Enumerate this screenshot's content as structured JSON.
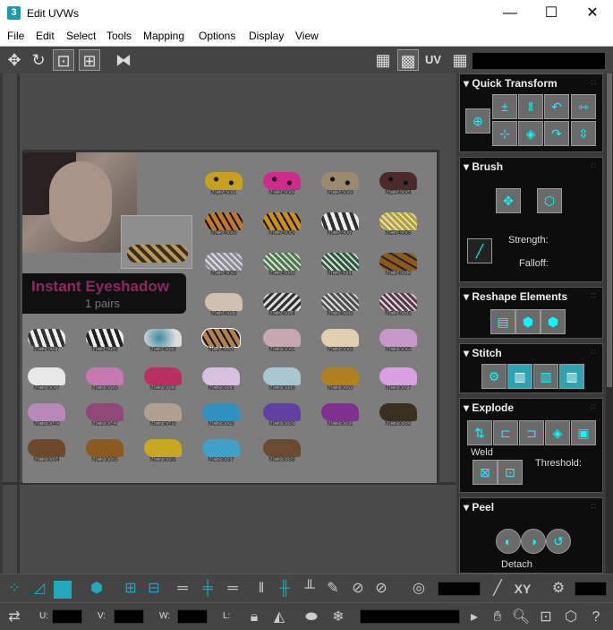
{
  "window": {
    "title": "Edit UVWs",
    "app_icon": "3",
    "minimize": "—",
    "maximize": "☐",
    "close": "✕"
  },
  "menu": [
    "File",
    "Edit",
    "Select",
    "Tools",
    "Mapping",
    "Options",
    "Display",
    "View"
  ],
  "toolbar": {
    "uv_label": "UV"
  },
  "texture": {
    "banner_title": "Instant Eyeshadow",
    "banner_sub": "1 pairs",
    "swatches": [
      {
        "id": "NC24001",
        "color": "#c8a020",
        "pattern": "leopard"
      },
      {
        "id": "NC24002",
        "color": "#d02a8a",
        "pattern": "leopard"
      },
      {
        "id": "NC24003",
        "color": "#9a8a70",
        "pattern": "leopard"
      },
      {
        "id": "NC24004",
        "color": "#4a2a2a",
        "pattern": "leopard"
      },
      {
        "id": "NC24005",
        "color": "#c07830",
        "pattern": "tiger"
      },
      {
        "id": "NC24006",
        "color": "#c89020",
        "pattern": "tiger"
      },
      {
        "id": "NC24007",
        "color": "#303030",
        "pattern": "zebra"
      },
      {
        "id": "NC24008",
        "color": "#b8a020",
        "pattern": "snake"
      },
      {
        "id": "NC24009",
        "color": "#8a8a9a",
        "pattern": "snake"
      },
      {
        "id": "NC24010",
        "color": "#4a7a4a",
        "pattern": "snake"
      },
      {
        "id": "NC24011",
        "color": "#2a5a3a",
        "pattern": "snake"
      },
      {
        "id": "NC24012",
        "color": "#8a5a20",
        "pattern": "giraffe"
      },
      {
        "id": "NC24013",
        "color": "#d0c0b0",
        "pattern": "plain"
      },
      {
        "id": "NC24014",
        "color": "#303030",
        "pattern": "zigzag"
      },
      {
        "id": "NC24015",
        "color": "#505050",
        "pattern": "snake"
      },
      {
        "id": "NC24016",
        "color": "#5a3a4a",
        "pattern": "snake"
      },
      {
        "id": "NC24017",
        "color": "#303030",
        "pattern": "zebra"
      },
      {
        "id": "NC24018",
        "color": "#202020",
        "pattern": "zebra"
      },
      {
        "id": "NC24019",
        "color": "#3a8a9a",
        "pattern": "swirl"
      },
      {
        "id": "NC24020",
        "color": "#b08050",
        "pattern": "tiger"
      },
      {
        "id": "NC23001",
        "color": "#c8a8b0",
        "pattern": "plain"
      },
      {
        "id": "NC23003",
        "color": "#e0d0b0",
        "pattern": "plain"
      },
      {
        "id": "NC23005",
        "color": "#c898c8",
        "pattern": "plain"
      },
      {
        "id": "NC23007",
        "color": "#e8e8e8",
        "pattern": "plain"
      },
      {
        "id": "NC23010",
        "color": "#c878b0",
        "pattern": "plain"
      },
      {
        "id": "NC23012",
        "color": "#b83060",
        "pattern": "plain"
      },
      {
        "id": "NC23013",
        "color": "#d8c0e0",
        "pattern": "plain"
      },
      {
        "id": "NC23018",
        "color": "#a8c8d0",
        "pattern": "plain"
      },
      {
        "id": "NC23020",
        "color": "#b08020",
        "pattern": "plain"
      },
      {
        "id": "NC23027",
        "color": "#d8a0e0",
        "pattern": "plain"
      },
      {
        "id": "NC23040",
        "color": "#b888b8",
        "pattern": "plain"
      },
      {
        "id": "NC23042",
        "color": "#904878",
        "pattern": "plain"
      },
      {
        "id": "NC23045",
        "color": "#b0a090",
        "pattern": "plain"
      },
      {
        "id": "NC23029",
        "color": "#3090c0",
        "pattern": "plain"
      },
      {
        "id": "NC23030",
        "color": "#6040a0",
        "pattern": "plain"
      },
      {
        "id": "NC23031",
        "color": "#803090",
        "pattern": "plain"
      },
      {
        "id": "NC23032",
        "color": "#3a3020",
        "pattern": "plain"
      },
      {
        "id": "NC23034",
        "color": "#6a4a2a",
        "pattern": "plain"
      },
      {
        "id": "NC23035",
        "color": "#8a5a20",
        "pattern": "plain"
      },
      {
        "id": "NC23036",
        "color": "#c8a820",
        "pattern": "plain"
      },
      {
        "id": "NC23037",
        "color": "#40a0c8",
        "pattern": "plain"
      },
      {
        "id": "NC23038",
        "color": "#6a4a30",
        "pattern": "plain"
      }
    ]
  },
  "panel": {
    "quick_transform": "Quick Transform",
    "brush": "Brush",
    "strength": "Strength:",
    "falloff": "Falloff:",
    "reshape": "Reshape Elements",
    "stitch": "Stitch",
    "explode": "Explode",
    "weld": "Weld",
    "threshold": "Threshold:",
    "peel": "Peel",
    "detach": "Detach"
  },
  "statusbar": {
    "xy": "XY",
    "u": "U:",
    "v": "V:",
    "w": "W:",
    "l": "L:"
  }
}
